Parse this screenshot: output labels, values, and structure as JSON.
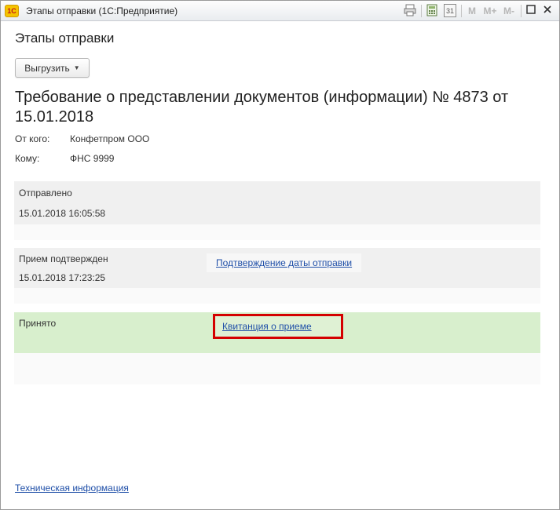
{
  "window": {
    "app_logo": "1С",
    "title": "Этапы отправки  (1С:Предприятие)",
    "toolbar": {
      "icons": [
        "print-icon",
        "calculator-icon",
        "calendar-icon"
      ],
      "calendar_day": "31",
      "memory_buttons": [
        "M",
        "M+",
        "M-"
      ],
      "minimize": "▁",
      "maximize": "□",
      "close": "✕"
    }
  },
  "form": {
    "title": "Этапы отправки",
    "export_button": "Выгрузить",
    "document_title": "Требование о представлении документов (информации) № 4873 от 15.01.2018",
    "from_label": "От кого:",
    "from_value": "Конфетпром ООО",
    "to_label": "Кому:",
    "to_value": "ФНС 9999"
  },
  "stages": [
    {
      "name": "Отправлено",
      "date": "15.01.2018 16:05:58",
      "link": ""
    },
    {
      "name": "Прием подтвержден",
      "date": "15.01.2018 17:23:25",
      "link": "Подтверждение даты отправки"
    },
    {
      "name": "Принято",
      "date": "",
      "link": "Квитанция о приеме",
      "highlighted": true
    }
  ],
  "footer": {
    "tech_info_link": "Техническая информация"
  },
  "colors": {
    "stage_grey": "#f0f0f0",
    "stage_green": "#d8efcd",
    "link": "#1f4fa8",
    "highlight_border": "#d40000"
  }
}
